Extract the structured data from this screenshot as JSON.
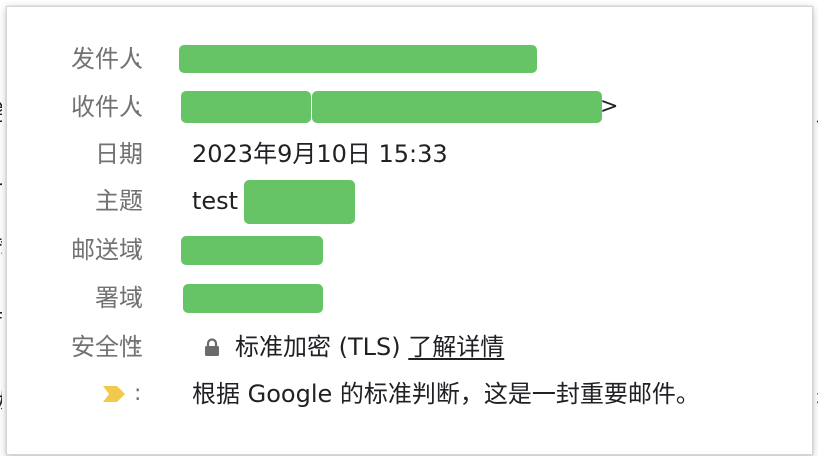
{
  "header": {
    "from_label": "发件人",
    "to_label": "收件人",
    "to_suffix": ">",
    "date_label": "日期",
    "date_value": "2023年9月10日 15:33",
    "subject_label": "主题",
    "subject_value": "test",
    "mailed_by_label": "邮送域",
    "signed_by_label": "署域",
    "security_label": "安全性",
    "security_value": "标准加密 (TLS)",
    "security_link": "了解详情",
    "importance_text": "根据 Google 的标准判断，这是一封重要邮件。",
    "colon": ":"
  },
  "icons": {
    "lock": "lock-icon",
    "importance": "importance-marker-icon"
  },
  "colors": {
    "redaction": "#66c466",
    "importance": "#f2c94c",
    "label": "#727272",
    "text": "#202124"
  }
}
